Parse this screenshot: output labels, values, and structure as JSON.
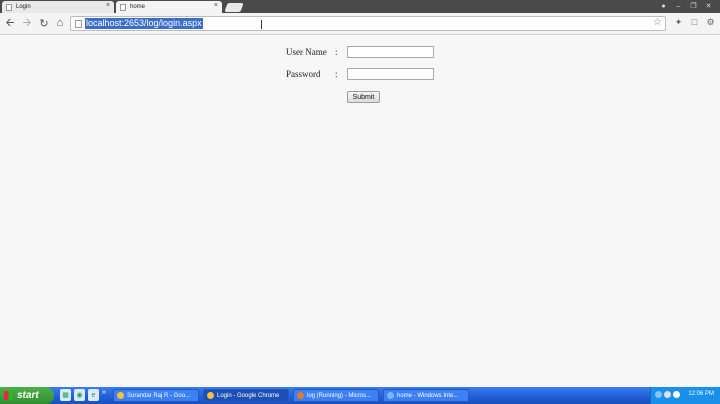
{
  "browser": {
    "tabs": [
      {
        "title": "Login"
      },
      {
        "title": "home"
      }
    ],
    "tab_close_glyph": "×",
    "url": "localhost:2653/log/login.aspx",
    "nav_icons": [
      "back-icon",
      "forward-icon",
      "reload-icon",
      "home-icon"
    ]
  },
  "form": {
    "username_label": "User Name",
    "password_label": "Password",
    "colon": ":",
    "username_value": "",
    "password_value": "",
    "submit_label": "Submit"
  },
  "taskbar": {
    "start_label": "start",
    "quicklaunch_more": "»",
    "tasks": [
      {
        "label": "Surandar Raj R - Goo..."
      },
      {
        "label": "Login - Google Chrome"
      },
      {
        "label": "log (Running) - Micros..."
      },
      {
        "label": "home - Windows Inte..."
      }
    ],
    "clock": "12:06 PM"
  },
  "colors": {
    "taskbar_blue": "#245edb",
    "start_green": "#3c9f3c",
    "url_selection": "#3b6ec9"
  }
}
